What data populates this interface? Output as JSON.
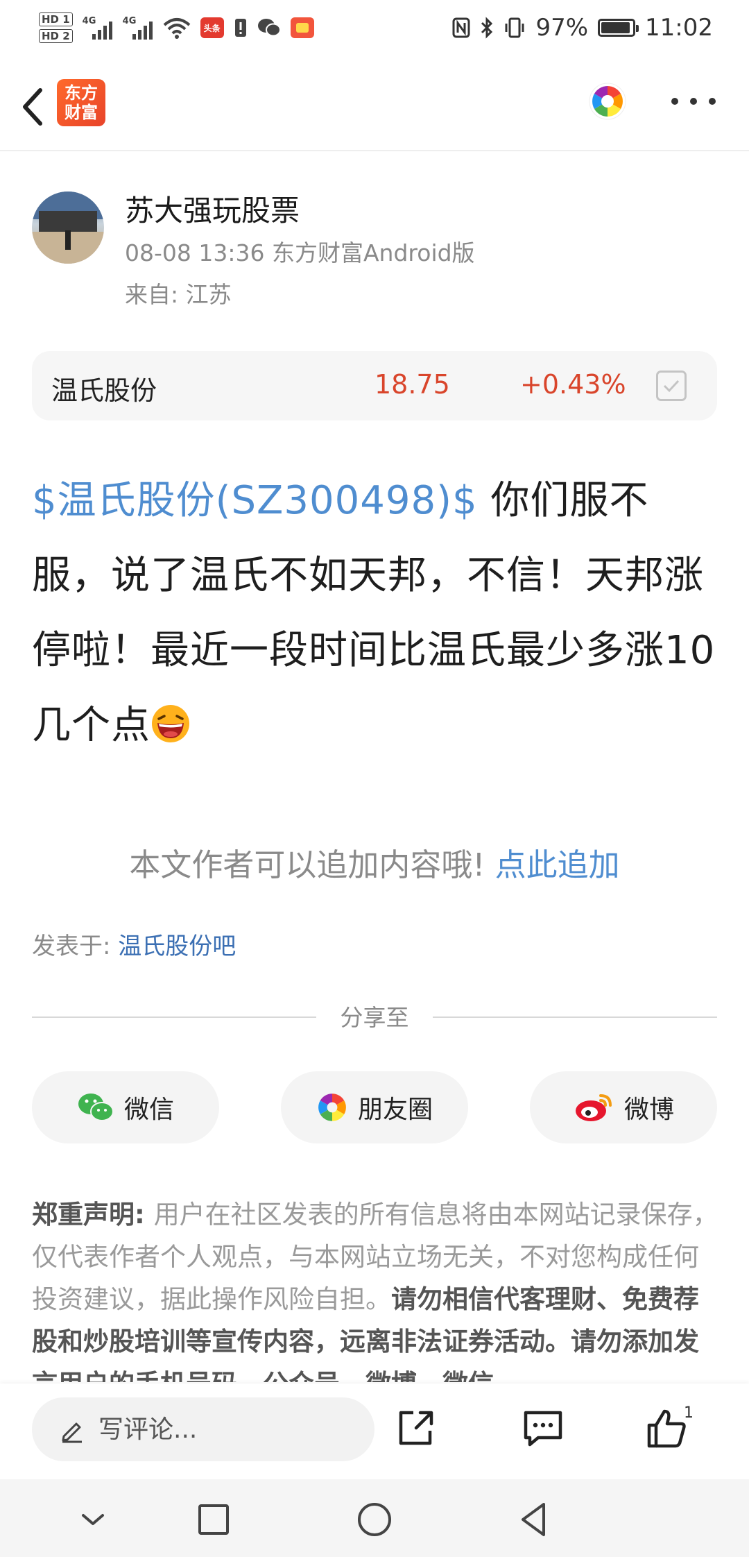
{
  "status_bar": {
    "hd1": "HD 1",
    "hd2": "HD 2",
    "net1": "4G",
    "net2": "4G",
    "toutiao_badge": "头条",
    "battery_percent": "97%",
    "battery_level": 0.97,
    "time": "11:02"
  },
  "app_header": {
    "logo_line1": "东方",
    "logo_line2": "财富"
  },
  "author": {
    "name": "苏大强玩股票",
    "meta": "08-08 13:36 东方财富Android版",
    "location": "来自: 江苏"
  },
  "stock": {
    "name": "温氏股份",
    "price": "18.75",
    "change": "+0.43%"
  },
  "post": {
    "tag": "$温氏股份(SZ300498)$",
    "text": " 你们服不服，说了温氏不如天邦，不信！天邦涨停啦！最近一段时间比温氏最少多涨10几个点"
  },
  "append": {
    "prompt": "本文作者可以追加内容哦!",
    "link": "点此追加"
  },
  "posted_in": {
    "label": "发表于: ",
    "bar_name": "温氏股份吧"
  },
  "share": {
    "title": "分享至",
    "wechat": "微信",
    "moments": "朋友圈",
    "weibo": "微博"
  },
  "disclaimer": {
    "heading": "郑重声明: ",
    "body": "用户在社区发表的所有信息将由本网站记录保存，仅代表作者个人观点，与本网站立场无关，不对您构成任何投资建议，据此操作风险自担。",
    "emphasis": "请勿相信代客理财、免费荐股和炒股培训等宣传内容，远离非法证券活动。请勿添加发言用户的手机号码、公众号、微博、微信"
  },
  "bottom_bar": {
    "comment_placeholder": "写评论...",
    "like_count": "1"
  },
  "colors": {
    "accent_blue": "#4f8dd0",
    "price_red": "#d9452b",
    "brand_orange": "#ff6a2b"
  }
}
